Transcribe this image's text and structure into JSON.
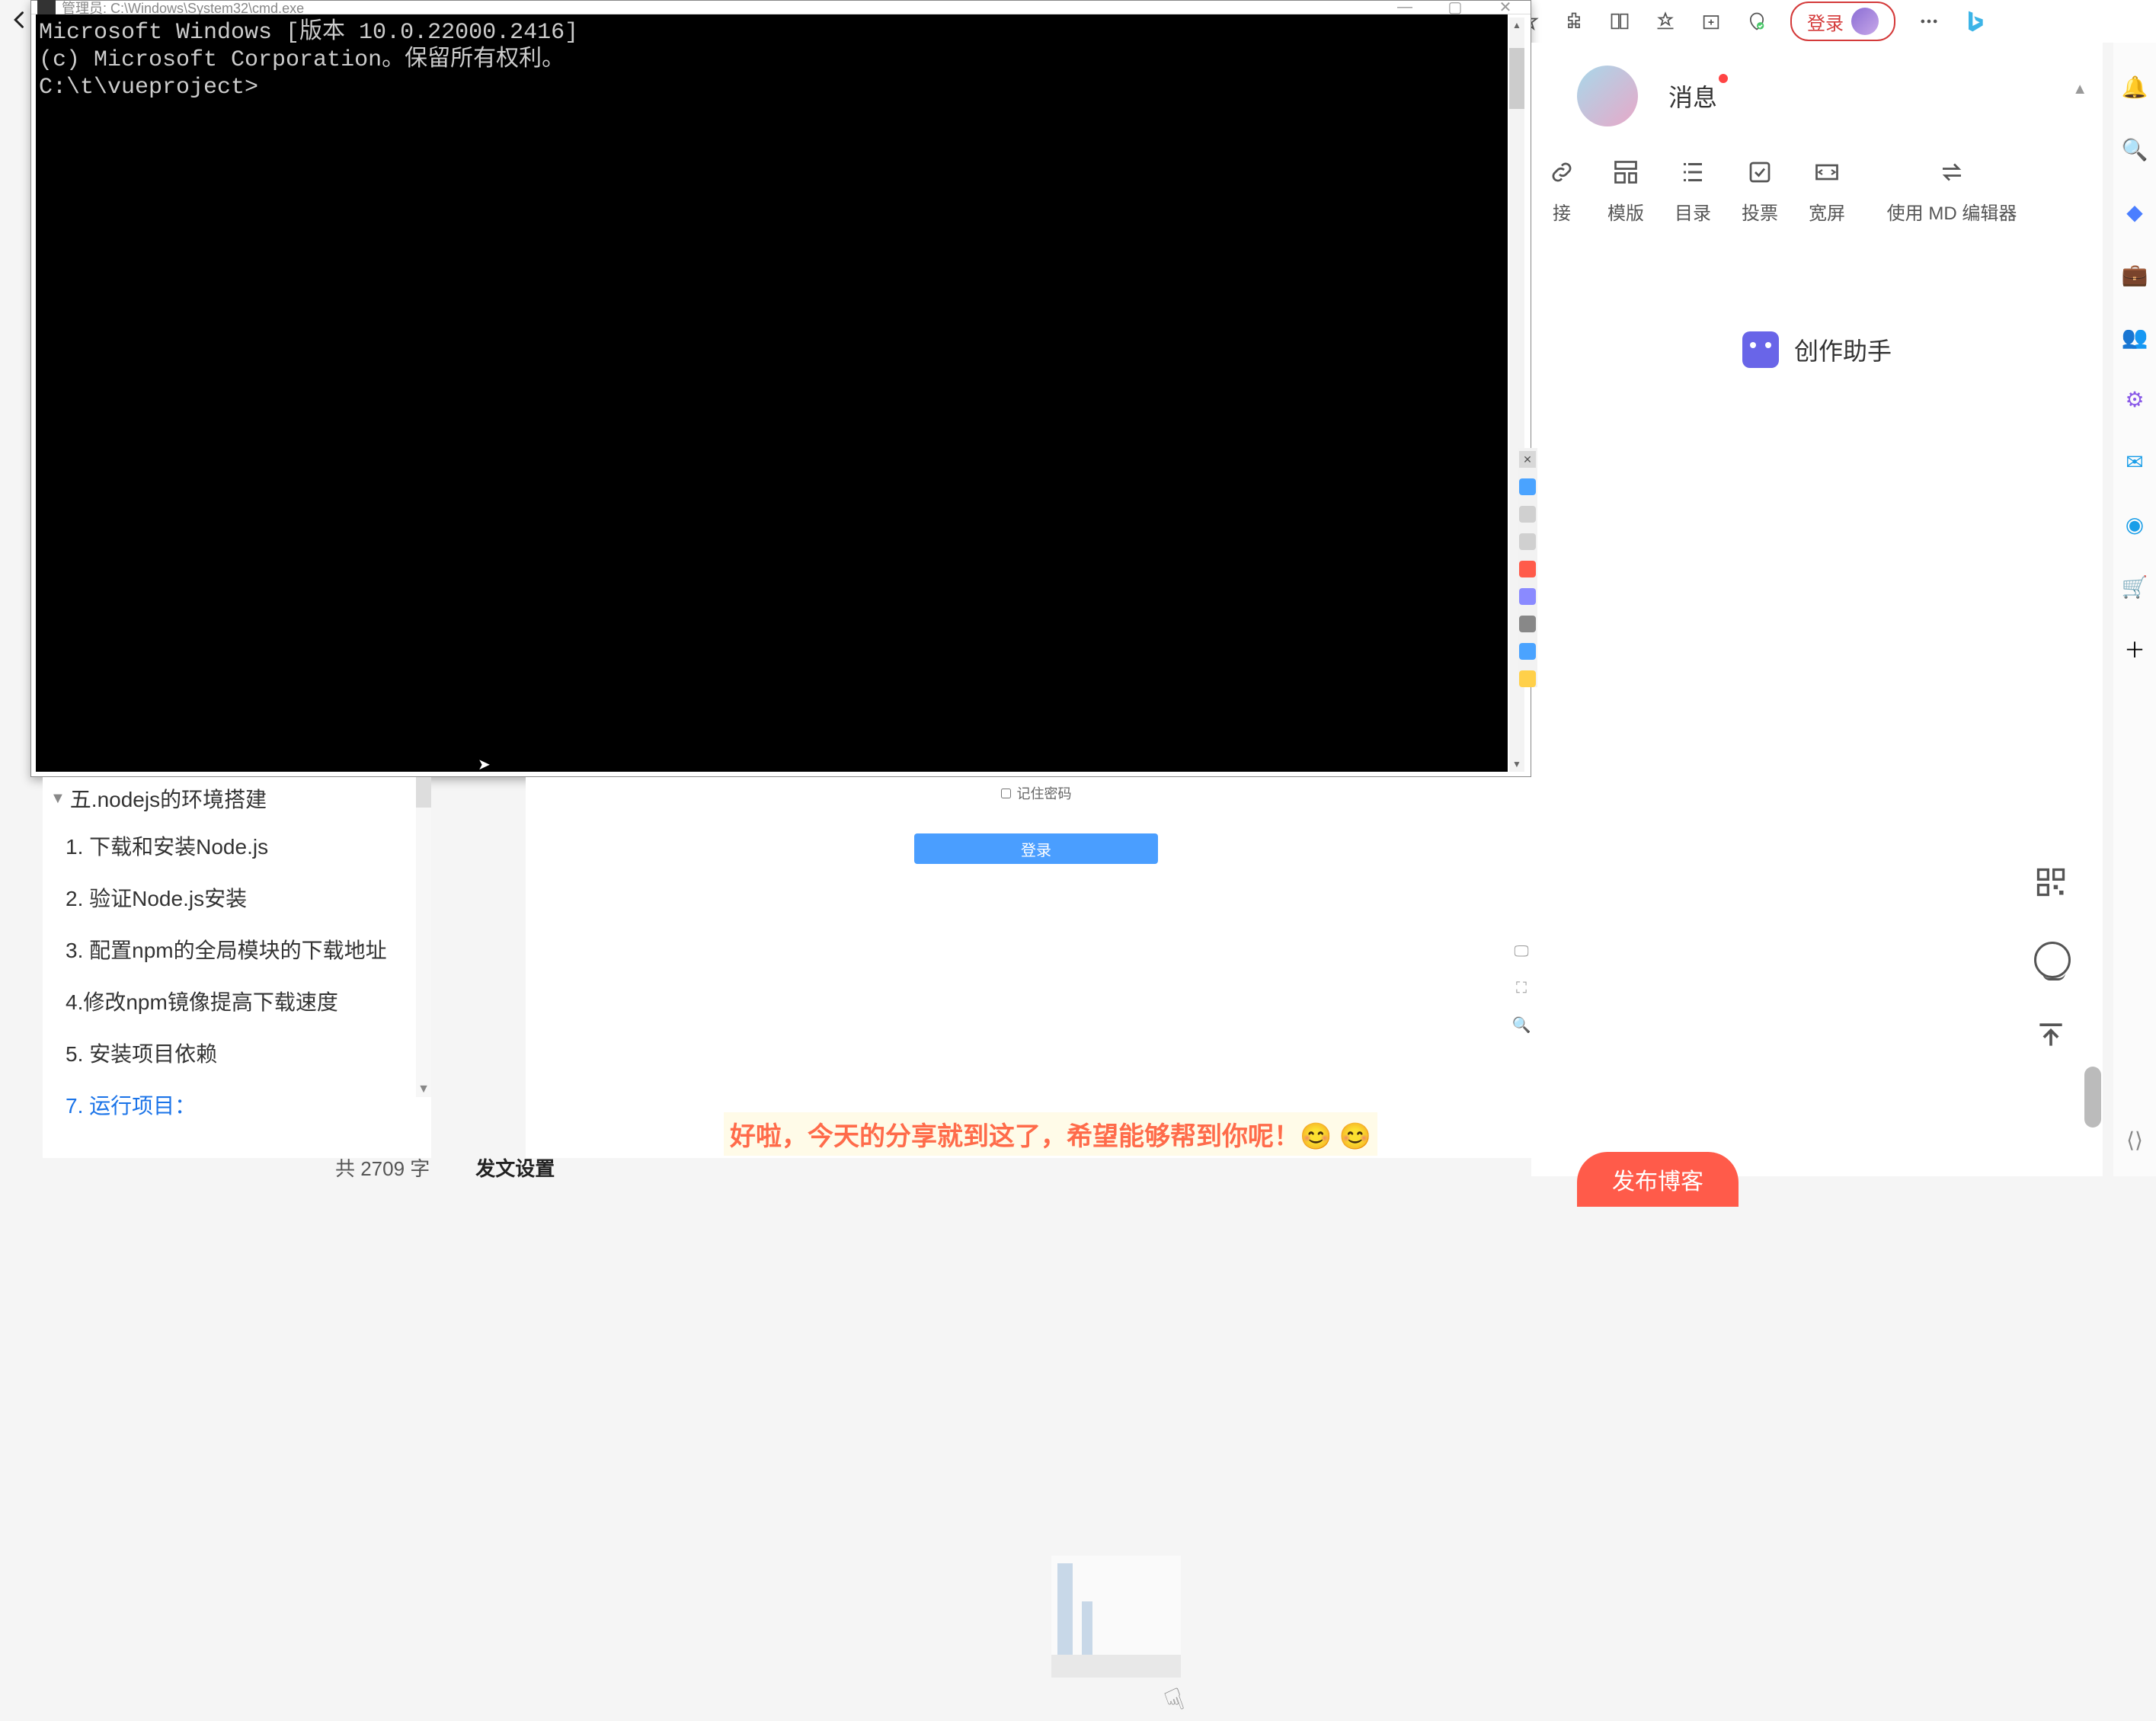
{
  "browser": {
    "login_label": "登录",
    "back_icon": "back-arrow"
  },
  "cmd": {
    "title": "管理员: C:\\Windows\\System32\\cmd.exe",
    "lines": [
      "Microsoft Windows [版本 10.0.22000.2416]",
      "(c) Microsoft Corporation。保留所有权利。",
      "",
      "C:\\t\\vueproject>"
    ]
  },
  "outline": {
    "header": "五.nodejs的环境搭建",
    "items": [
      "1. 下载和安装Node.js",
      "2. 验证Node.js安装",
      "3. 配置npm的全局模块的下载地址",
      "4.修改npm镜像提高下载速度",
      "5. 安装项目依赖",
      "7. 运行项目："
    ],
    "active_index": 5
  },
  "login_form": {
    "remember_label": "记住密码",
    "login_button": "登录"
  },
  "ending_text": "好啦，今天的分享就到这了，希望能够帮到你呢！😊 😊",
  "right_panel": {
    "message_label": "消息",
    "tools": [
      {
        "icon": "link-icon",
        "label": "接"
      },
      {
        "icon": "template-icon",
        "label": "模版"
      },
      {
        "icon": "toc-icon",
        "label": "目录"
      },
      {
        "icon": "vote-icon",
        "label": "投票"
      },
      {
        "icon": "widescreen-icon",
        "label": "宽屏"
      },
      {
        "icon": "md-editor-icon",
        "label": "使用 MD 编辑器"
      }
    ],
    "assist_label": "创作助手"
  },
  "footer": {
    "word_count": "共 2709 字",
    "publish_settings": "发文设置",
    "publish_button": "发布博客"
  },
  "far_sidebar_icons": [
    "bell-icon",
    "search-icon",
    "diamond-icon",
    "briefcase-icon",
    "people-icon",
    "gear-icon",
    "outlook-icon",
    "edge-icon",
    "cart-icon",
    "plus-icon"
  ],
  "float_strip_colors": [
    "#4aa3ff",
    "#ffb84a",
    "#d0d0d0",
    "#ff5b4a",
    "#8a8aff",
    "#888888",
    "#4aa3ff",
    "#ffd04a"
  ]
}
